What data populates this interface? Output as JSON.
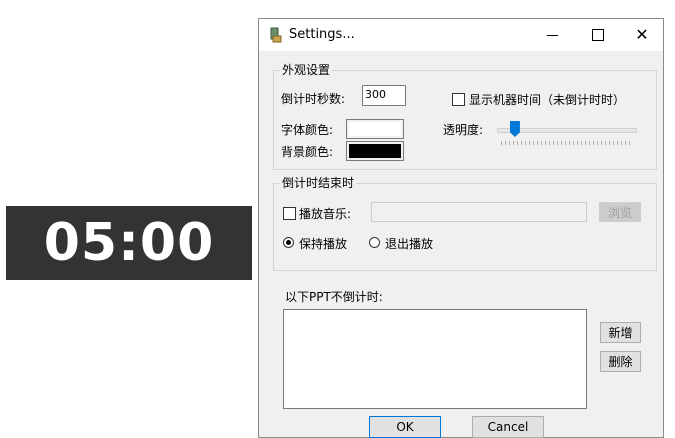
{
  "timer": {
    "display": "05:00"
  },
  "dialog": {
    "title": "Settings...",
    "window_controls": {
      "minimize": "minimize-icon",
      "maximize": "maximize-icon",
      "close": "close-icon"
    },
    "appearance": {
      "group_title": "外观设置",
      "countdown_seconds_label": "倒计时秒数:",
      "countdown_seconds_value": "300",
      "show_machine_time_label": "显示机器时间（未倒计时时）",
      "show_machine_time_checked": false,
      "font_color_label": "字体颜色:",
      "font_color": "#ffffff",
      "background_color_label": "背景颜色:",
      "background_color": "#000000",
      "opacity_label": "透明度:",
      "opacity_level": 0.13
    },
    "on_end": {
      "group_title": "倒计时结束时",
      "play_music_label": "播放音乐:",
      "play_music_checked": false,
      "music_path_value": "",
      "browse_button": "浏览",
      "keep_playing_label": "保持播放",
      "keep_playing_selected": true,
      "exit_playing_label": "退出播放",
      "exit_playing_selected": false
    },
    "exclusions": {
      "label": "以下PPT不倒计时:",
      "items": [],
      "add_button": "新增",
      "delete_button": "删除"
    },
    "footer": {
      "ok_button": "OK",
      "cancel_button": "Cancel"
    }
  }
}
